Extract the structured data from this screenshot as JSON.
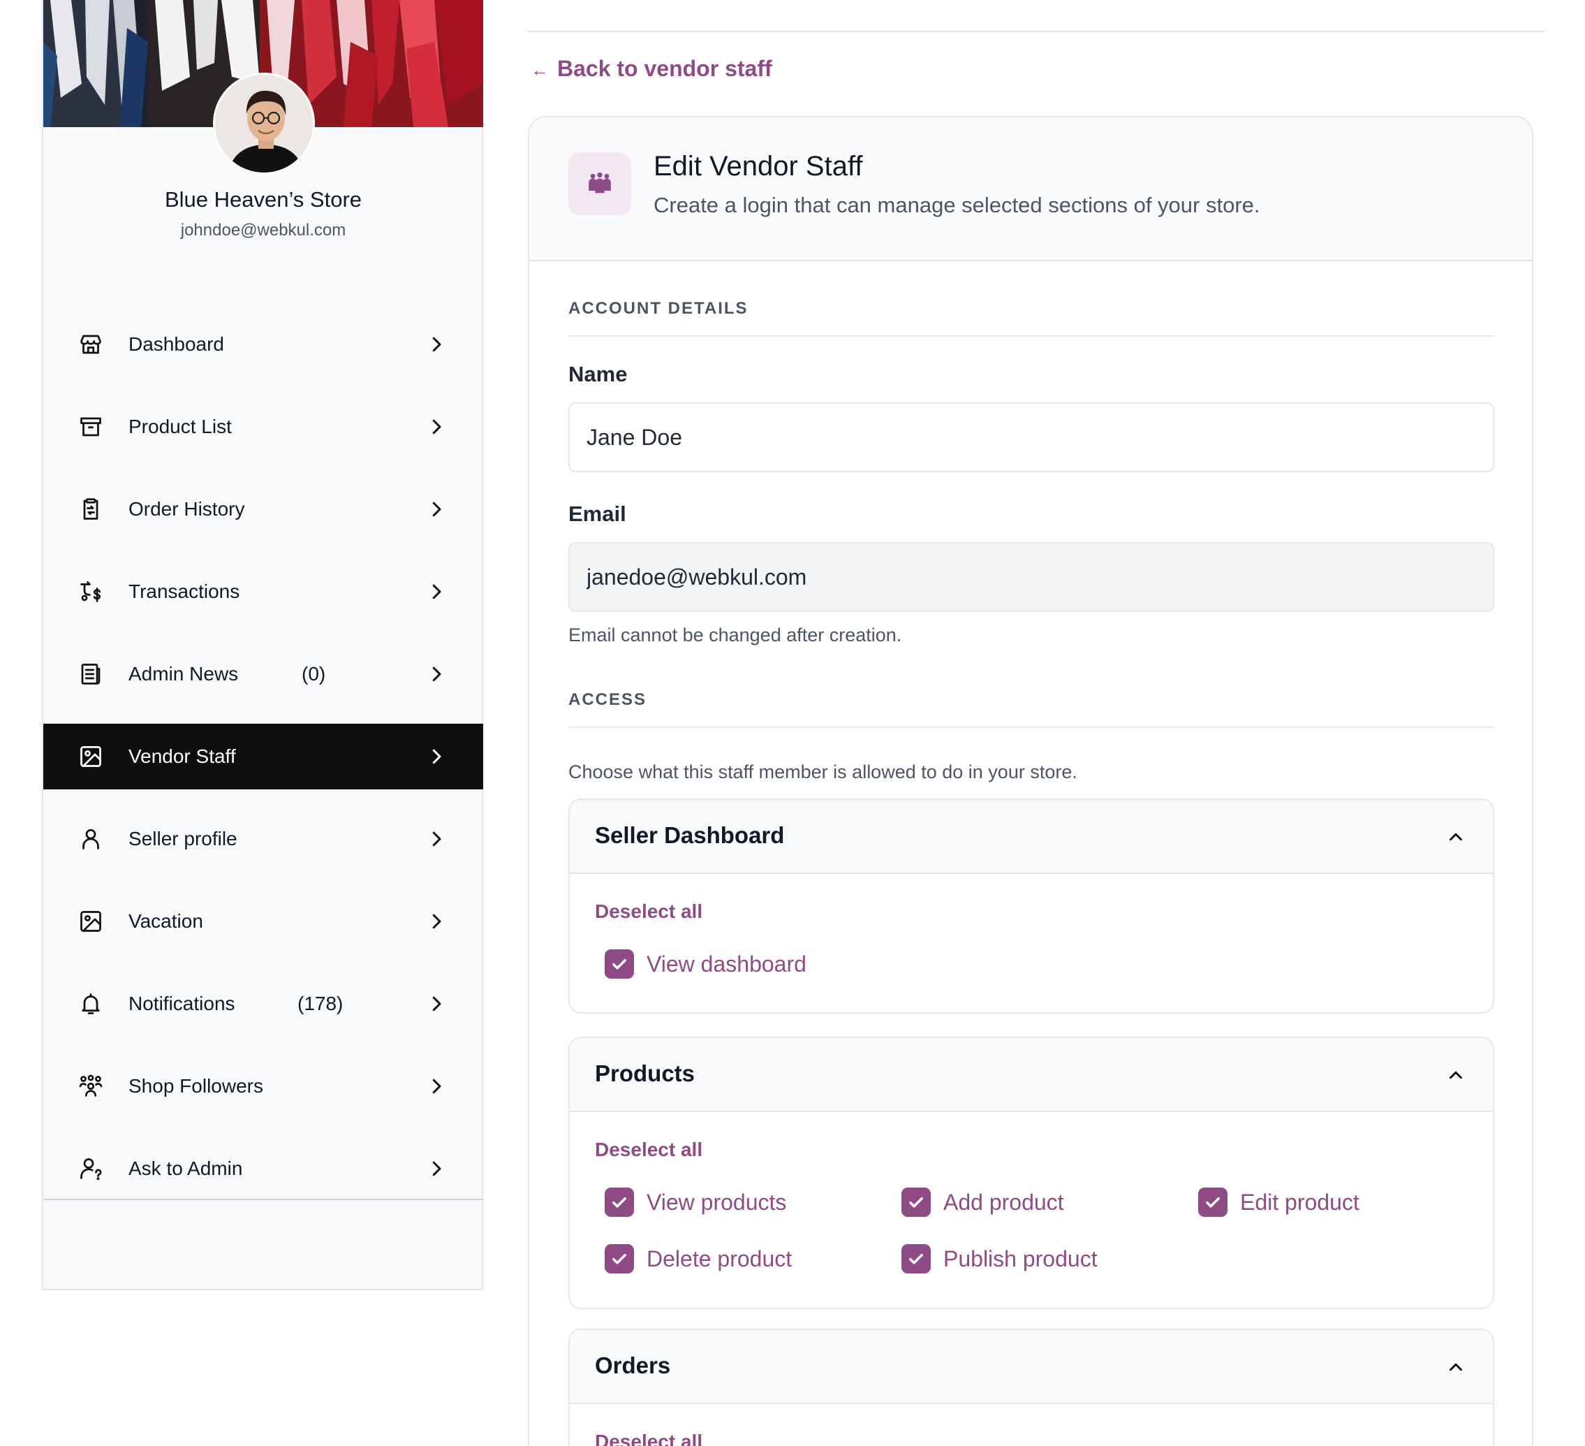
{
  "sidebar": {
    "store_name": "Blue Heaven’s Store",
    "store_email": "johndoe@webkul.com",
    "items": [
      {
        "label": "Dashboard",
        "count": "",
        "icon": "store-icon"
      },
      {
        "label": "Product List",
        "count": "",
        "icon": "archive-icon"
      },
      {
        "label": "Order History",
        "count": "",
        "icon": "order-history-icon"
      },
      {
        "label": "Transactions",
        "count": "",
        "icon": "transactions-icon"
      },
      {
        "label": "Admin News",
        "count": "(0)",
        "icon": "news-icon"
      },
      {
        "label": "Vendor Staff",
        "count": "",
        "icon": "image-icon",
        "active": true
      },
      {
        "label": "Seller profile",
        "count": "",
        "icon": "user-icon"
      },
      {
        "label": "Vacation",
        "count": "",
        "icon": "image-icon"
      },
      {
        "label": "Notifications",
        "count": "(178)",
        "icon": "bell-icon"
      },
      {
        "label": "Shop Followers",
        "count": "",
        "icon": "followers-icon"
      },
      {
        "label": "Ask to Admin",
        "count": "",
        "icon": "user-question-icon"
      }
    ]
  },
  "main": {
    "back_link": "Back to vendor staff",
    "header": {
      "title": "Edit Vendor Staff",
      "subtitle": "Create a login that can manage selected sections of your store."
    },
    "account": {
      "section_title": "ACCOUNT DETAILS",
      "name_label": "Name",
      "name_value": "Jane Doe",
      "email_label": "Email",
      "email_value": "janedoe@webkul.com",
      "email_helper": "Email cannot be changed after creation."
    },
    "access": {
      "section_title": "ACCESS",
      "description": "Choose what this staff member is allowed to do in your store.",
      "deselect_label": "Deselect all",
      "groups": [
        {
          "title": "Seller Dashboard",
          "permissions": [
            "View dashboard"
          ]
        },
        {
          "title": "Products",
          "permissions": [
            "View products",
            "Add product",
            "Edit product",
            "Delete product",
            "Publish product"
          ]
        },
        {
          "title": "Orders",
          "permissions": []
        }
      ]
    }
  },
  "colors": {
    "accent": "#8e4b86",
    "active_nav_bg": "#0f0f10",
    "sidebar_bg": "#f8f9fb"
  }
}
